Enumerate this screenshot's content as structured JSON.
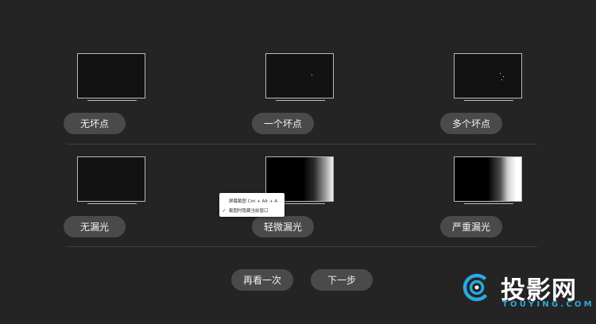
{
  "row1": [
    {
      "label": "无坏点",
      "screen": "dark",
      "dead_pixels": 0
    },
    {
      "label": "一个坏点",
      "screen": "dark",
      "dead_pixels": 1
    },
    {
      "label": "多个坏点",
      "screen": "dark",
      "dead_pixels": 3
    }
  ],
  "row2": [
    {
      "label": "无漏光",
      "screen": "dark"
    },
    {
      "label": "轻微漏光",
      "screen": "black-light-leak"
    },
    {
      "label": "严重漏光",
      "screen": "black-heavy-leak"
    }
  ],
  "actions": {
    "retry": "再看一次",
    "next": "下一步"
  },
  "context_menu": {
    "items": [
      {
        "label": "屏幕截图 Ctrl + Alt + A",
        "checked": false
      },
      {
        "label": "截图时隐藏当前窗口",
        "checked": true
      }
    ],
    "check_glyph": "✓"
  },
  "logo": {
    "text": "投影网",
    "subtext": "TOUYING.COM",
    "accent": "#29aae1"
  },
  "colors": {
    "background": "#242424",
    "button": "#4a4a4a",
    "divider": "#3e3e3e"
  }
}
